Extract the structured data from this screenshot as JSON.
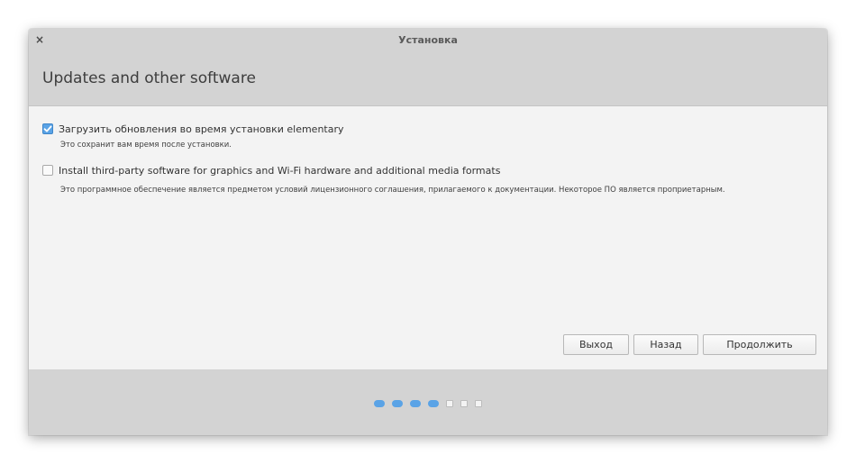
{
  "window": {
    "title": "Установка",
    "close_glyph": "×"
  },
  "header": {
    "title": "Updates and other software"
  },
  "options": [
    {
      "label": "Загрузить обновления во время установки elementary",
      "description": "Это сохранит вам время после установки.",
      "checked": true
    },
    {
      "label": "Install third-party software for graphics and Wi-Fi hardware and additional media formats",
      "description": "Это программное обеспечение является предметом условий лицензионного соглашения, прилагаемого к документации. Некоторое ПО является проприетарным.",
      "checked": false
    }
  ],
  "buttons": {
    "quit": "Выход",
    "back": "Назад",
    "continue": "Продолжить"
  },
  "progress": {
    "total_steps": 7,
    "completed_steps": 4
  },
  "colors": {
    "accent": "#5aa3e6",
    "header_bg": "#d3d3d3",
    "content_bg": "#f3f3f3"
  }
}
